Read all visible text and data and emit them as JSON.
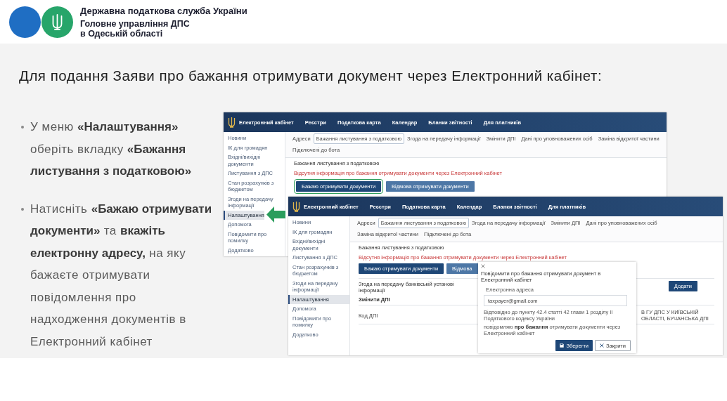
{
  "header": {
    "lines": [
      "Державна податкова служба України",
      "Головне управління ДПС",
      "в Одеській області"
    ]
  },
  "title": "Для подання Заяви про бажання отримувати документ через Електронний кабінет:",
  "bullets": [
    "У меню **«Налаштування»** оберіть вкладку **«Бажання листування з податковою»**",
    "Натисніть **«Бажаю отримувати документи»** та **вкажіть електронну адресу,** на яку бажаєте отримувати повідомлення про надходження документів в Електронний кабінет"
  ],
  "screenshots": [
    {
      "brand": "Електронний кабінет",
      "menu": [
        "Реєстри",
        "Податкова карта",
        "Календар",
        "Бланки звітності",
        "Для платників"
      ],
      "sidebar": [
        {
          "label": "Новини",
          "selected": false
        },
        {
          "label": "ІК для громадян",
          "selected": false
        },
        {
          "label": "Вхідні/вихідні документи",
          "selected": false
        },
        {
          "label": "Листування з ДПС",
          "selected": false
        },
        {
          "label": "Стан розрахунків з бюджетом",
          "selected": false
        },
        {
          "label": "Згоди на передачу інформації",
          "selected": false
        },
        {
          "label": "Налаштування",
          "selected": true
        },
        {
          "label": "Допомога",
          "selected": false
        },
        {
          "label": "Повідомити про помилку",
          "selected": false
        },
        {
          "label": "Додатково",
          "selected": false
        }
      ],
      "tabs": [
        {
          "label": "Адреси",
          "selected": false
        },
        {
          "label": "Бажання листування з податковою",
          "selected": true
        },
        {
          "label": "Згода на передачу інформації",
          "selected": false
        },
        {
          "label": "Змінити ДПІ",
          "selected": false
        },
        {
          "label": "Дані про уповноважених осіб",
          "selected": false
        },
        {
          "label": "Заміна відкритої частини",
          "selected": false
        },
        {
          "label": "Підключені до бота",
          "selected": false
        }
      ],
      "section_title": "Бажання листування з податковою",
      "notice": "Відсутня інформація про бажання отримувати документи через Електронний кабінет",
      "buttons": [
        {
          "label": "Бажаю отримувати документи",
          "kind": "primary",
          "highlighted": true
        },
        {
          "label": "Відмова отримувати документи",
          "kind": "secondary",
          "highlighted": false
        }
      ]
    },
    {
      "brand": "Електронний кабінет",
      "menu": [
        "Реєстри",
        "Податкова карта",
        "Календар",
        "Бланки звітності",
        "Для платників"
      ],
      "sidebar": [
        {
          "label": "Новини",
          "selected": false
        },
        {
          "label": "ІК для громадян",
          "selected": false
        },
        {
          "label": "Вхідні/вихідні документи",
          "selected": false
        },
        {
          "label": "Листування з ДПС",
          "selected": false
        },
        {
          "label": "Стан розрахунків з бюджетом",
          "selected": false
        },
        {
          "label": "Згоди на передачу інформації",
          "selected": false
        },
        {
          "label": "Налаштування",
          "selected": true
        },
        {
          "label": "Допомога",
          "selected": false
        },
        {
          "label": "Повідомити про помилку",
          "selected": false
        },
        {
          "label": "Додатково",
          "selected": false
        }
      ],
      "tabs": [
        {
          "label": "Адреси",
          "selected": false
        },
        {
          "label": "Бажання листування з податковою",
          "selected": true
        },
        {
          "label": "Згода на передачу інформації",
          "selected": false
        },
        {
          "label": "Змінити ДПІ",
          "selected": false
        },
        {
          "label": "Дані про уповноважених осіб",
          "selected": false
        },
        {
          "label": "Заміна відкритої частини",
          "selected": false
        },
        {
          "label": "Підключені до бота",
          "selected": false
        }
      ],
      "section_title": "Бажання листування з податковою",
      "notice": "Відсутня інформація про бажання отримувати документи через Електронний кабінет",
      "buttons": [
        {
          "label": "Бажаю отримувати документи",
          "kind": "primary",
          "highlighted": false
        },
        {
          "label": "Відмова",
          "kind": "secondary",
          "highlighted": false
        }
      ],
      "consent": {
        "label": "Згода на передачу банківській установі інформації",
        "button": "Додати"
      },
      "dpi": {
        "heading": "Змінити ДПІ",
        "field_label": "Код ДПІ",
        "field_value": "В ГУ ДПС У КИЇВСЬКІЙ ОБЛАСТІ, БУЧАНСЬКА ДПІ"
      },
      "dialog": {
        "title": "Повідомити про бажання отримувати документ в Електронний кабінет",
        "email": {
          "label": "Електронна адреса",
          "value": "taxpayer@gmail.com"
        },
        "legal_text": "Відповідно до пункту 42.4 статті 42 глави 1 розділу II Податкового кодексу України",
        "statement": "повідомляю **про бажання** отримувати документи через Електронний кабінет",
        "buttons": [
          {
            "label": "Зберегти",
            "kind": "save"
          },
          {
            "label": "Закрити",
            "kind": "close"
          }
        ]
      }
    }
  ]
}
